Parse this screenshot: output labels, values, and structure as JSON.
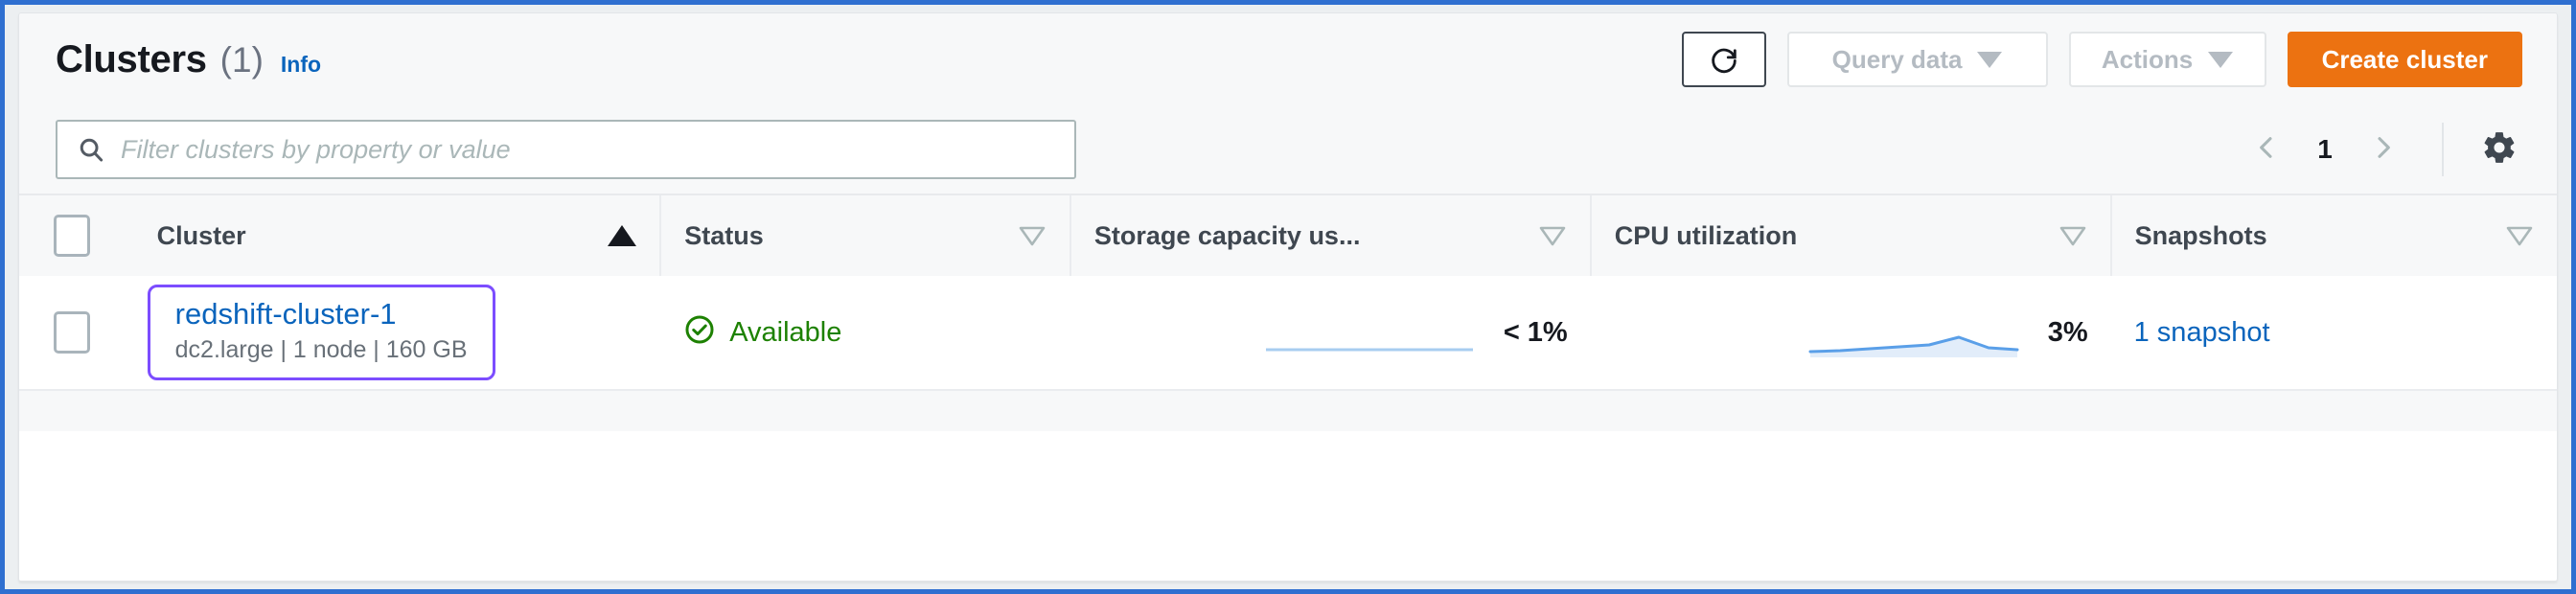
{
  "header": {
    "title": "Clusters",
    "count": "(1)",
    "info_label": "Info",
    "refresh_icon": "refresh-icon",
    "query_data_label": "Query data",
    "query_data_enabled": false,
    "actions_label": "Actions",
    "actions_enabled": false,
    "create_label": "Create cluster",
    "create_color": "#ec7211"
  },
  "filter": {
    "search_icon": "search-icon",
    "placeholder": "Filter clusters by property or value",
    "value": ""
  },
  "pagination": {
    "prev_icon": "chevron-left-icon",
    "next_icon": "chevron-right-icon",
    "current_page": "1",
    "settings_icon": "gear-icon"
  },
  "table": {
    "select_all_checkbox": false,
    "columns": [
      {
        "key": "cluster",
        "label": "Cluster",
        "sort": "asc-active"
      },
      {
        "key": "status",
        "label": "Status",
        "sort": "inactive"
      },
      {
        "key": "storage",
        "label": "Storage capacity us...",
        "sort": "inactive"
      },
      {
        "key": "cpu",
        "label": "CPU utilization",
        "sort": "inactive"
      },
      {
        "key": "snapshots",
        "label": "Snapshots",
        "sort": "inactive"
      }
    ],
    "rows": [
      {
        "selected": false,
        "cluster_name": "redshift-cluster-1",
        "cluster_details": "dc2.large | 1 node | 160 GB",
        "focused": true,
        "status_icon": "check-circle-icon",
        "status_text": "Available",
        "status_color": "#1d8102",
        "storage_value": "< 1%",
        "cpu_value": "3%",
        "snapshots_text": "1 snapshot"
      }
    ]
  },
  "chart_data": [
    {
      "type": "line",
      "title": "Storage capacity used",
      "name": "storage-sparkline",
      "x": [
        0,
        1,
        2,
        3,
        4,
        5,
        6,
        7
      ],
      "values": [
        0.4,
        0.4,
        0.4,
        0.4,
        0.4,
        0.4,
        0.4,
        0.4
      ],
      "ylim": [
        0,
        100
      ],
      "color": "#a8cdf0",
      "latest_label": "< 1%"
    },
    {
      "type": "line",
      "title": "CPU utilization",
      "name": "cpu-sparkline",
      "x": [
        0,
        1,
        2,
        3,
        4,
        5,
        6,
        7
      ],
      "values": [
        2.0,
        2.2,
        2.6,
        3.0,
        3.2,
        4.4,
        2.8,
        2.6
      ],
      "ylim": [
        0,
        100
      ],
      "color": "#5a9fe8",
      "latest_label": "3%"
    }
  ]
}
